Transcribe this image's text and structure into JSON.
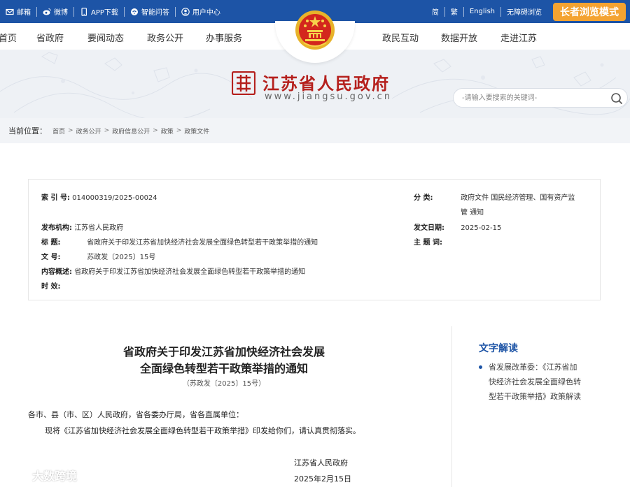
{
  "topbar": {
    "links": [
      {
        "label": "邮箱",
        "icon": "mail-icon"
      },
      {
        "label": "微博",
        "icon": "weibo-icon"
      },
      {
        "label": "APP下载",
        "icon": "phone-icon"
      },
      {
        "label": "智能问答",
        "icon": "qa-icon"
      },
      {
        "label": "用户中心",
        "icon": "user-icon"
      }
    ],
    "lang_simplified": "简",
    "lang_traditional": "繁",
    "lang_english": "English",
    "accessibility": "无障碍浏览",
    "elder_mode": "长者浏览模式"
  },
  "nav": {
    "home": "首页",
    "gov": "省政府",
    "news": "要闻动态",
    "affairs": "政务公开",
    "services": "办事服务",
    "interaction": "政民互动",
    "opendata": "数据开放",
    "about": "走进江苏"
  },
  "site": {
    "title": "江苏省人民政府",
    "url": "www.jiangsu.gov.cn"
  },
  "search": {
    "placeholder": "-请输入要搜索的关键词-"
  },
  "breadcrumb": {
    "label": "当前位置：",
    "items": [
      "首页",
      "政务公开",
      "政府信息公开",
      "政策",
      "政策文件"
    ],
    "sep": ">"
  },
  "meta": {
    "index_label": "索 引 号:",
    "index_value": "014000319/2025-00024",
    "category_label": "分 类:",
    "category_value_1": "政府文件 国民经济管理、国有资产监",
    "category_value_2": "管 通知",
    "publisher_label": "发布机构:",
    "publisher_value": "江苏省人民政府",
    "date_label": "发文日期:",
    "date_value": "2025-02-15",
    "title_label": "标 题:",
    "title_value": "省政府关于印发江苏省加快经济社会发展全面绿色转型若干政策举措的通知",
    "keywords_label": "主 题 词:",
    "keywords_value": "",
    "docno_label": "文 号:",
    "docno_value": "苏政发〔2025〕15号",
    "summary_label": "内容概述:",
    "summary_value": "省政府关于印发江苏省加快经济社会发展全面绿色转型若干政策举措的通知",
    "validity_label": "时 效:",
    "validity_value": ""
  },
  "article": {
    "title_line1": "省政府关于印发江苏省加快经济社会发展",
    "title_line2": "全面绿色转型若干政策举措的通知",
    "doc_number": "（苏政发〔2025〕15号）",
    "addressee": "各市、县（市、区）人民政府，省各委办厅局，省各直属单位：",
    "body": "现将《江苏省加快经济社会发展全面绿色转型若干政策举措》印发给你们，请认真贯彻落实。",
    "signer": "江苏省人民政府",
    "sign_date": "2025年2月15日"
  },
  "sidebar": {
    "title": "文字解读",
    "items": [
      {
        "line1": "省发展改革委：《江苏省加",
        "line2": "快经济社会发展全面绿色转",
        "line3": "型若干政策举措》政策解读"
      }
    ]
  },
  "watermark": {
    "text": "大数跨境"
  },
  "colors": {
    "primary_blue": "#1d54a6",
    "brand_red": "#b5201d",
    "elder_orange": "#f4a331"
  }
}
